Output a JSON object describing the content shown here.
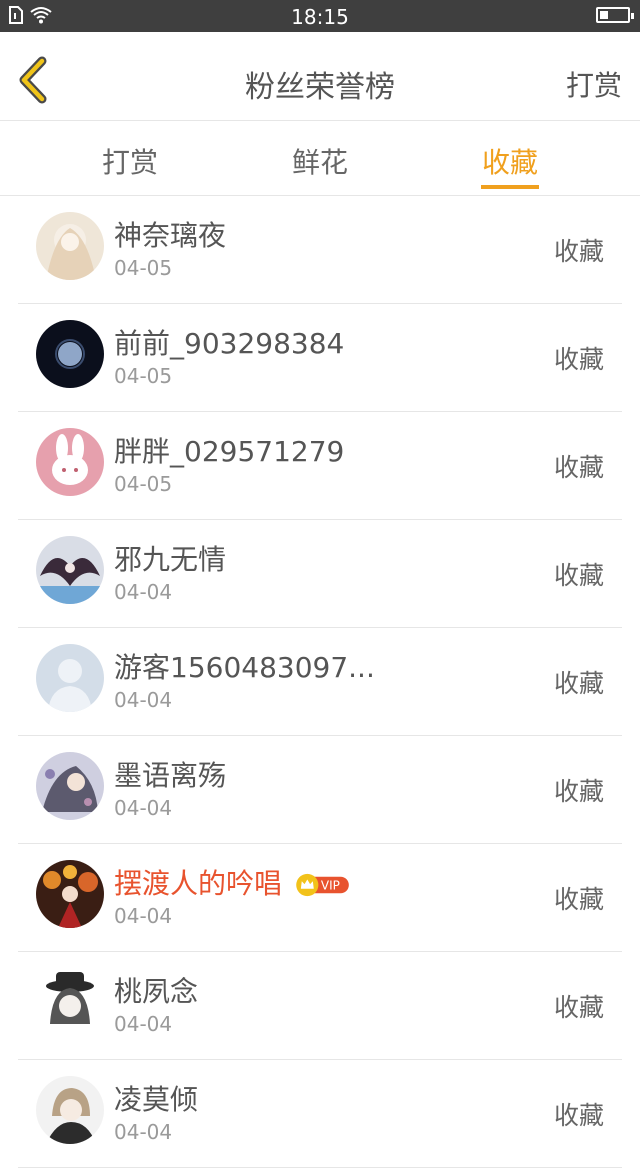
{
  "status_bar": {
    "time": "18:15"
  },
  "header": {
    "title": "粉丝荣誉榜",
    "action_label": "打赏"
  },
  "tabs": [
    {
      "label": "打赏",
      "active": false
    },
    {
      "label": "鲜花",
      "active": false
    },
    {
      "label": "收藏",
      "active": true
    }
  ],
  "colors": {
    "accent": "#f0a01e",
    "vip_name": "#e8532e",
    "vip_badge": "#e8532e"
  },
  "fans": [
    {
      "name": "神奈璃夜",
      "date": "04-05",
      "action": "收藏"
    },
    {
      "name": "前前_903298384",
      "date": "04-05",
      "action": "收藏"
    },
    {
      "name": "胖胖_029571279",
      "date": "04-05",
      "action": "收藏"
    },
    {
      "name": "邪九无情",
      "date": "04-04",
      "action": "收藏"
    },
    {
      "name": "游客1560483097...",
      "date": "04-04",
      "action": "收藏"
    },
    {
      "name": "墨语离殇",
      "date": "04-04",
      "action": "收藏"
    },
    {
      "name": "摆渡人的吟唱",
      "date": "04-04",
      "action": "收藏",
      "vip_label": "VIP"
    },
    {
      "name": "桃夙念",
      "date": "04-04",
      "action": "收藏"
    },
    {
      "name": "凌莫倾",
      "date": "04-04",
      "action": "收藏"
    }
  ]
}
